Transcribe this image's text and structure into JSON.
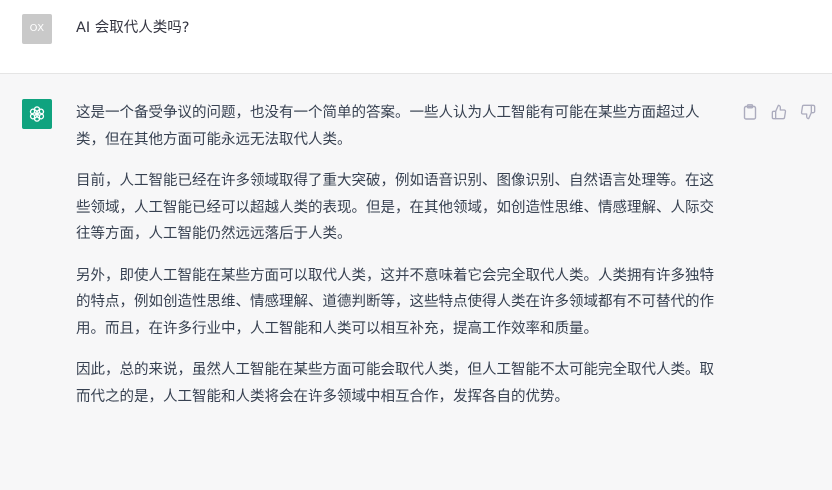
{
  "user": {
    "avatar_initials": "OX",
    "question": "AI 会取代人类吗?"
  },
  "assistant": {
    "avatar_icon": "openai-logo-icon",
    "paragraphs": [
      "这是一个备受争议的问题，也没有一个简单的答案。一些人认为人工智能有可能在某些方面超过人类，但在其他方面可能永远无法取代人类。",
      "目前，人工智能已经在许多领域取得了重大突破，例如语音识别、图像识别、自然语言处理等。在这些领域，人工智能已经可以超越人类的表现。但是，在其他领域，如创造性思维、情感理解、人际交往等方面，人工智能仍然远远落后于人类。",
      "另外，即使人工智能在某些方面可以取代人类，这并不意味着它会完全取代人类。人类拥有许多独特的特点，例如创造性思维、情感理解、道德判断等，这些特点使得人类在许多领域都有不可替代的作用。而且，在许多行业中，人工智能和人类可以相互补充，提高工作效率和质量。",
      "因此，总的来说，虽然人工智能在某些方面可能会取代人类，但人工智能不太可能完全取代人类。取而代之的是，人工智能和人类将会在许多领域中相互合作，发挥各自的优势。"
    ],
    "actions": [
      "clipboard-icon",
      "thumbs-up-icon",
      "thumbs-down-icon"
    ]
  },
  "colors": {
    "assistant_bg": "#f7f7f8",
    "gpt_avatar": "#10a37f",
    "user_avatar": "#c9c9c9",
    "text": "#374151",
    "icon": "#acacbe"
  }
}
